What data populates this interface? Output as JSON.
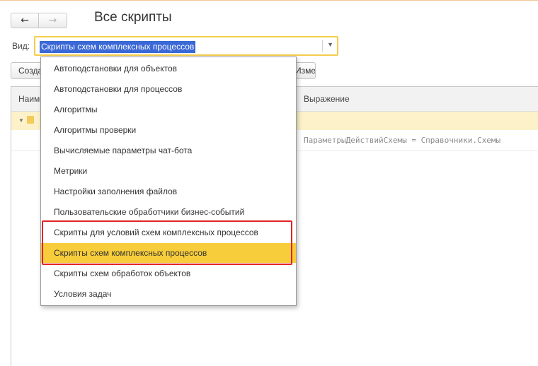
{
  "header": {
    "title": "Все скрипты"
  },
  "view": {
    "label": "Вид:",
    "selected": "Скрипты схем комплексных процессов"
  },
  "toolbar": {
    "create_label": "Создать",
    "other_label": "Изменения"
  },
  "table": {
    "columns": [
      "Наименование",
      "Выражение"
    ],
    "rows": [
      {
        "expression": "ПараметрыДействийСхемы = Справочники.Схемы"
      }
    ]
  },
  "dropdown": {
    "items": [
      "Автоподстановки для объектов",
      "Автоподстановки для процессов",
      "Алгоритмы",
      "Алгоритмы проверки",
      "Вычисляемые параметры чат-бота",
      "Метрики",
      "Настройки заполнения файлов",
      "Пользовательские обработчики бизнес-событий",
      "Скрипты для условий схем комплексных процессов",
      "Скрипты схем комплексных процессов",
      "Скрипты схем обработок объектов",
      "Условия задач"
    ],
    "selected_index": 9
  },
  "colors": {
    "accent": "#f7cd3b",
    "selection": "#3a68d6",
    "annotation": "#e02424"
  }
}
